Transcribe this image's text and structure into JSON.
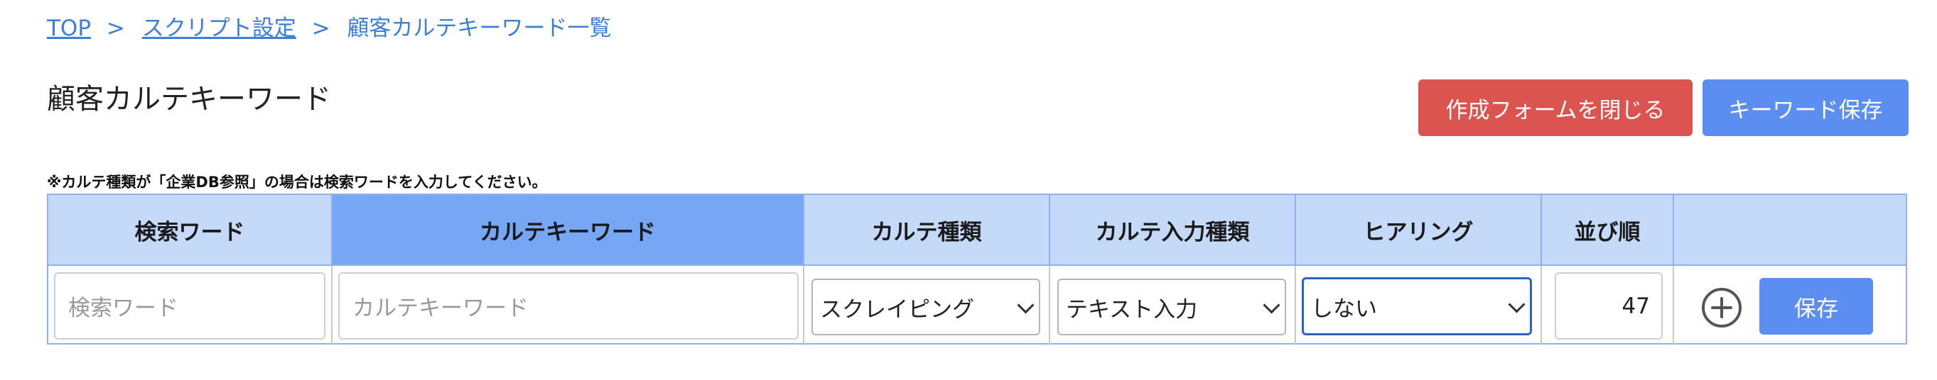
{
  "breadcrumb": {
    "top": "TOP",
    "script_settings": "スクリプト設定",
    "current": "顧客カルテキーワード一覧",
    "separator": ">"
  },
  "page": {
    "title": "顧客カルテキーワード",
    "note": "※カルテ種類が「企業DB参照」の場合は検索ワードを入力してください。"
  },
  "buttons": {
    "close_form": "作成フォームを閉じる",
    "save_keyword": "キーワード保存",
    "row_save": "保存"
  },
  "table": {
    "headers": {
      "search_word": "検索ワード",
      "karte_keyword": "カルテキーワード",
      "karte_type": "カルテ種類",
      "karte_input_type": "カルテ入力種類",
      "hearing": "ヒアリング",
      "order": "並び順"
    },
    "row": {
      "search_word_placeholder": "検索ワード",
      "karte_keyword_placeholder": "カルテキーワード",
      "karte_type": "スクレイピング",
      "karte_input_type": "テキスト入力",
      "hearing": "しない",
      "order": "47"
    }
  },
  "colors": {
    "link": "#3b7fd8",
    "danger": "#dc5450",
    "primary": "#5b8ef0",
    "header_bg": "#c5daf9",
    "header_bg_active": "#77a6f5"
  },
  "icons": {
    "add": "plus-circle-icon",
    "dropdown": "chevron-down-icon"
  }
}
